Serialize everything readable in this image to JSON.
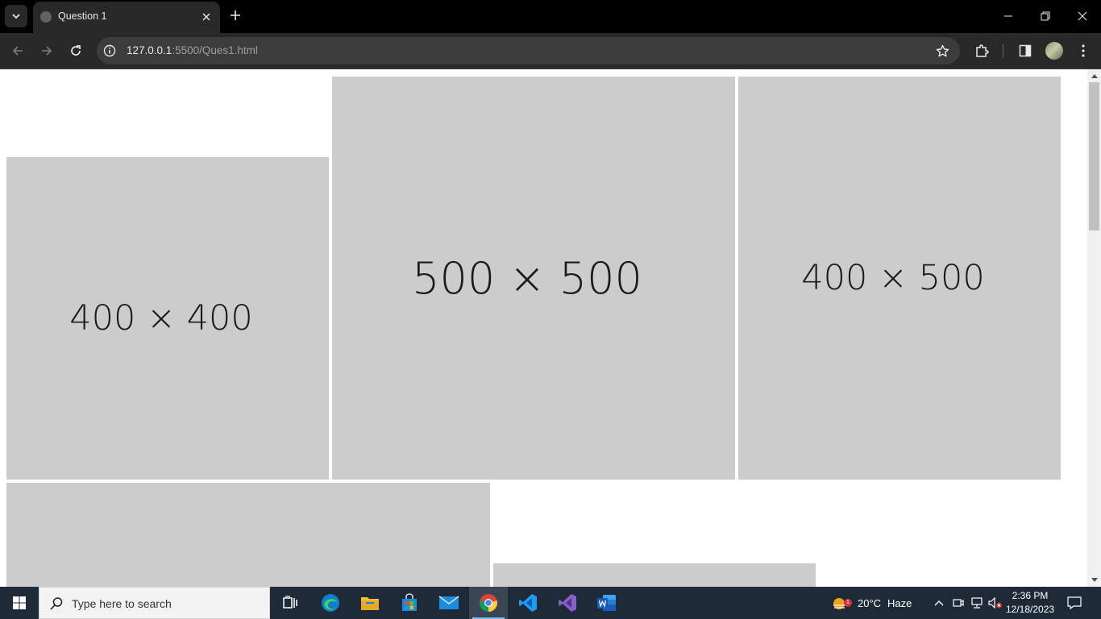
{
  "browser": {
    "tab": {
      "title": "Question 1",
      "favicon": "globe-icon"
    },
    "address": {
      "host": "127.0.0.1",
      "path": ":5500/Ques1.html"
    }
  },
  "page": {
    "placeholders": [
      {
        "label": "400 × 400"
      },
      {
        "label": "500 × 500"
      },
      {
        "label": "400 × 500"
      },
      {
        "label": ""
      },
      {
        "label": ""
      }
    ],
    "placeholder_color": "#cccccc",
    "text_color": "#1a1a1a"
  },
  "taskbar": {
    "search_placeholder": "Type here to search",
    "apps": [
      "task-view",
      "edge",
      "file-explorer",
      "microsoft-store",
      "mail",
      "chrome",
      "vscode",
      "visual-studio",
      "word"
    ],
    "active_app": "chrome",
    "weather": {
      "temperature": "20°C",
      "condition": "Haze",
      "badge": "1"
    },
    "clock": {
      "time": "2:36 PM",
      "date": "12/18/2023"
    }
  }
}
